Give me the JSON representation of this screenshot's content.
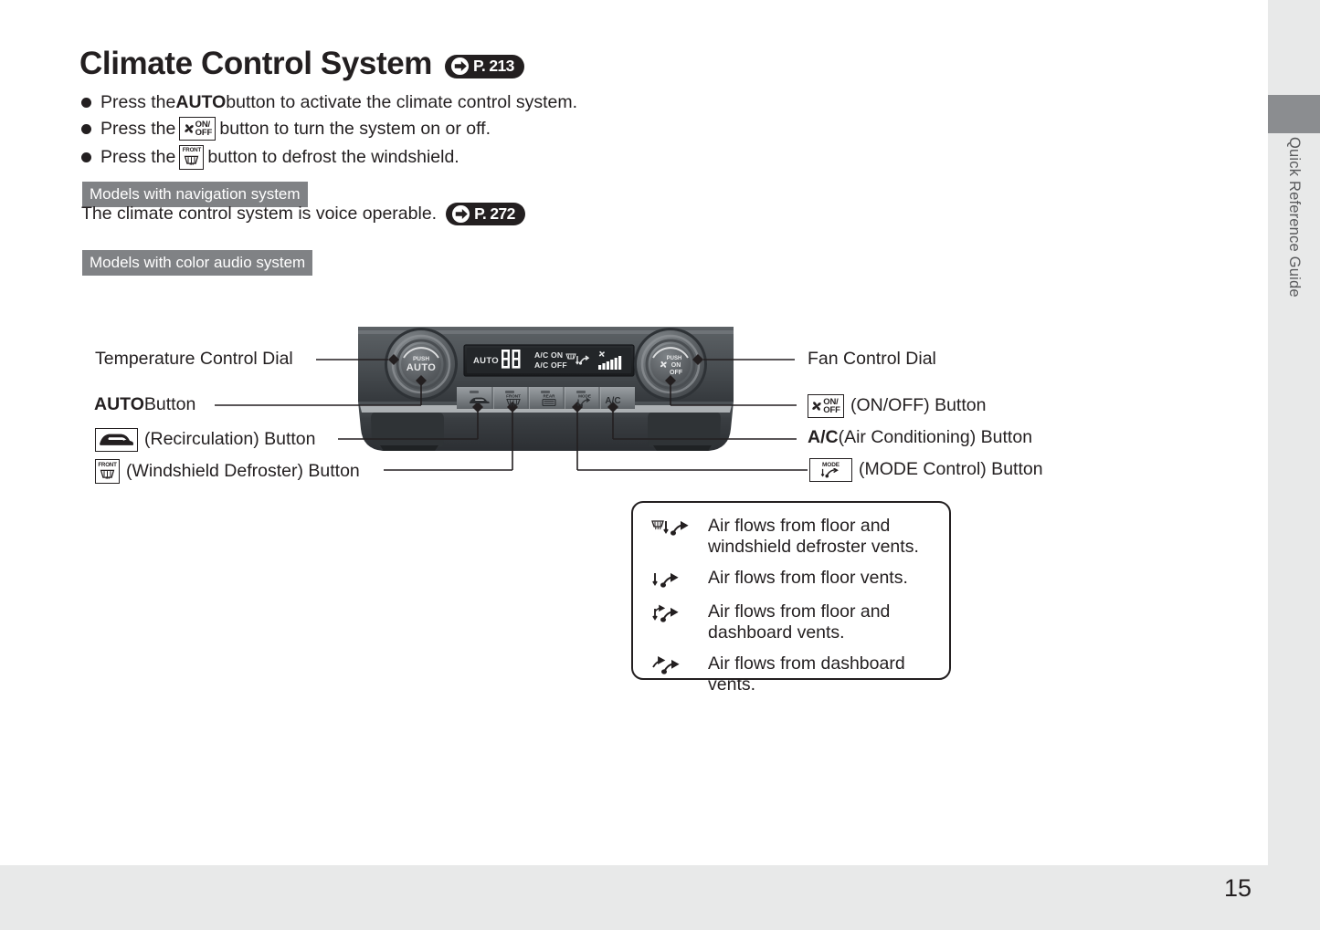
{
  "page": {
    "number": "15",
    "tab_label": "Quick Reference Guide"
  },
  "header": {
    "title": "Climate Control System",
    "page_ref": "P. 213"
  },
  "bullets": [
    {
      "pre": "Press the ",
      "bold": "AUTO",
      "post": " button to activate the climate control system.",
      "icon": null
    },
    {
      "pre": "Press the ",
      "bold": "",
      "post": " button to turn the system on or off.",
      "icon": "fan-onoff-icon"
    },
    {
      "pre": "Press the ",
      "bold": "",
      "post": " button to defrost the windshield.",
      "icon": "front-defroster-icon"
    }
  ],
  "sections": [
    {
      "label": "Models with navigation system",
      "text": "The climate control system is voice operable.",
      "page_ref": "P. 272"
    },
    {
      "label": "Models with color audio system",
      "text": "",
      "page_ref": ""
    }
  ],
  "panel": {
    "left_dial": {
      "line1": "PUSH",
      "line2": "AUTO"
    },
    "right_dial": {
      "line1": "PUSH",
      "line2": "ON",
      "line3": "OFF"
    },
    "display": {
      "auto": "AUTO",
      "temp": "88",
      "ac_on": "A/C ON",
      "ac_off": "A/C OFF"
    },
    "buttons": [
      {
        "name": "recirculation-button",
        "label": ""
      },
      {
        "name": "front-defroster-button",
        "label": "FRONT"
      },
      {
        "name": "rear-defroster-button",
        "label": "REAR"
      },
      {
        "name": "mode-button",
        "label": "MODE"
      },
      {
        "name": "ac-button",
        "label": "A/C"
      }
    ]
  },
  "callouts": {
    "left": [
      {
        "id": "temperature-control-dial",
        "text": "Temperature Control Dial",
        "icon": null,
        "bold": null
      },
      {
        "id": "auto-button",
        "text": " Button",
        "icon": null,
        "bold": "AUTO"
      },
      {
        "id": "recirculation-button",
        "text": " (Recirculation) Button",
        "icon": "recirculation-icon",
        "bold": null
      },
      {
        "id": "windshield-defroster-button",
        "text": " (Windshield Defroster) Button",
        "icon": "front-defroster-icon",
        "bold": null
      }
    ],
    "right": [
      {
        "id": "fan-control-dial",
        "text": "Fan Control Dial",
        "icon": null,
        "bold": null
      },
      {
        "id": "onoff-button",
        "text": " (ON/OFF) Button",
        "icon": "fan-onoff-icon",
        "bold": null
      },
      {
        "id": "ac-button",
        "text": " (Air Conditioning) Button",
        "icon": null,
        "bold": "A/C"
      },
      {
        "id": "mode-control-button",
        "text": " (MODE Control) Button",
        "icon": "mode-icon",
        "bold": null
      }
    ]
  },
  "legend": [
    {
      "icon": "airflow-defrost-floor-icon",
      "text": "Air flows from floor and windshield defroster vents."
    },
    {
      "icon": "airflow-floor-icon",
      "text": "Air flows from floor vents."
    },
    {
      "icon": "airflow-floor-dash-icon",
      "text": "Air flows from floor and dashboard vents."
    },
    {
      "icon": "airflow-dash-icon",
      "text": "Air flows from dashboard vents."
    }
  ],
  "colors": {
    "ink": "#231f20",
    "section_label_bg": "#808285",
    "margin_gray": "#e8e9e9",
    "tab_gray": "#8b8d90"
  }
}
